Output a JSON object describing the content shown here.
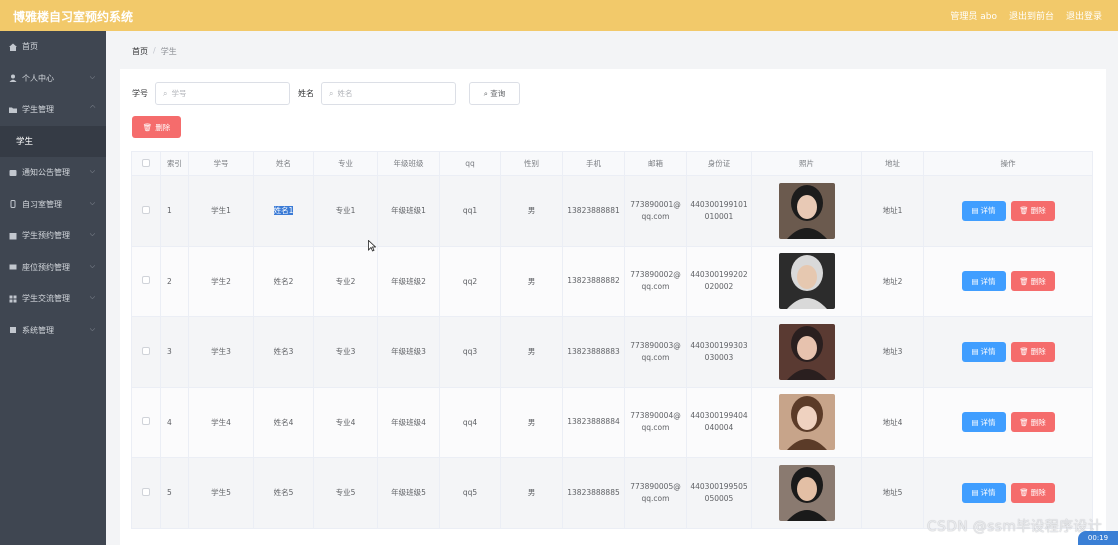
{
  "header": {
    "title": "博雅楼自习室预约系统",
    "admin_label": "管理员 abo",
    "back_front_label": "退出到前台",
    "logout_label": "退出登录"
  },
  "sidebar": {
    "items": [
      {
        "label": "首页",
        "icon": "home-icon",
        "has_chevron": false
      },
      {
        "label": "个人中心",
        "icon": "user-icon",
        "has_chevron": true
      },
      {
        "label": "学生管理",
        "icon": "folder-icon",
        "has_chevron": true,
        "expanded": true
      },
      {
        "label": "学生",
        "sub": true
      },
      {
        "label": "通知公告管理",
        "icon": "bell-icon",
        "has_chevron": true
      },
      {
        "label": "自习室管理",
        "icon": "door-icon",
        "has_chevron": true
      },
      {
        "label": "学生预约管理",
        "icon": "calendar-icon",
        "has_chevron": true
      },
      {
        "label": "座位预约管理",
        "icon": "seat-icon",
        "has_chevron": true
      },
      {
        "label": "学生交流管理",
        "icon": "chat-icon",
        "has_chevron": true
      },
      {
        "label": "系统管理",
        "icon": "gear-icon",
        "has_chevron": true
      }
    ]
  },
  "breadcrumb": {
    "home": "首页",
    "separator": "/",
    "current": "学生"
  },
  "search": {
    "student_no_label": "学号",
    "student_no_placeholder": "学号",
    "name_label": "姓名",
    "name_placeholder": "姓名",
    "query_label": "查询"
  },
  "actions": {
    "delete_label": "删除"
  },
  "table": {
    "columns": [
      "索引",
      "学号",
      "姓名",
      "专业",
      "年级班级",
      "qq",
      "性别",
      "手机",
      "邮箱",
      "身份证",
      "照片",
      "地址",
      "操作"
    ],
    "detail_label": "详情",
    "delete_label": "删除",
    "rows": [
      {
        "index": "1",
        "no": "学生1",
        "name": "姓名1",
        "major": "专业1",
        "grade": "年级班级1",
        "qq": "qq1",
        "gender": "男",
        "phone": "13823888881",
        "email": "773890001@qq.com",
        "idcard": "440300199101010001",
        "address": "地址1"
      },
      {
        "index": "2",
        "no": "学生2",
        "name": "姓名2",
        "major": "专业2",
        "grade": "年级班级2",
        "qq": "qq2",
        "gender": "男",
        "phone": "13823888882",
        "email": "773890002@qq.com",
        "idcard": "440300199202020002",
        "address": "地址2"
      },
      {
        "index": "3",
        "no": "学生3",
        "name": "姓名3",
        "major": "专业3",
        "grade": "年级班级3",
        "qq": "qq3",
        "gender": "男",
        "phone": "13823888883",
        "email": "773890003@qq.com",
        "idcard": "440300199303030003",
        "address": "地址3"
      },
      {
        "index": "4",
        "no": "学生4",
        "name": "姓名4",
        "major": "专业4",
        "grade": "年级班级4",
        "qq": "qq4",
        "gender": "男",
        "phone": "13823888884",
        "email": "773890004@qq.com",
        "idcard": "440300199404040004",
        "address": "地址4"
      },
      {
        "index": "5",
        "no": "学生5",
        "name": "姓名5",
        "major": "专业5",
        "grade": "年级班级5",
        "qq": "qq5",
        "gender": "男",
        "phone": "13823888885",
        "email": "773890005@qq.com",
        "idcard": "440300199505050005",
        "address": "地址5"
      }
    ]
  },
  "watermark": "CSDN @ssm毕设程序设计",
  "badge": "00:19",
  "colors": {
    "topbar": "#f2c96a",
    "sidebar": "#3f4651",
    "primary": "#409eff",
    "danger": "#f56c6c"
  }
}
